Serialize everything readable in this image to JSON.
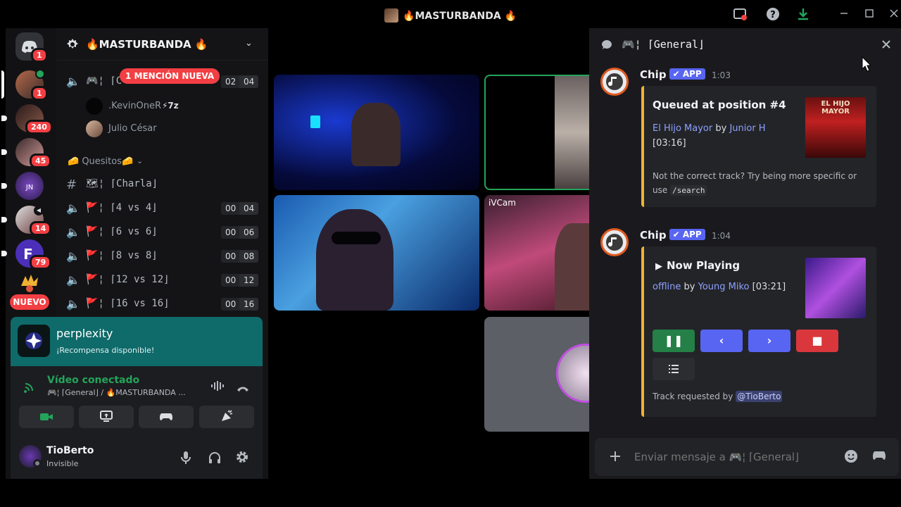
{
  "window": {
    "title": "🔥MASTURBANDA 🔥"
  },
  "rail": {
    "home_badge": "1",
    "servers": [
      {
        "badge": "1"
      },
      {
        "badge": "240"
      },
      {
        "badge": "45"
      },
      {
        "badge": ""
      },
      {
        "badge": "14"
      },
      {
        "badge": "79"
      },
      {
        "badge": ""
      }
    ],
    "new_label": "NUEVO"
  },
  "sidebar": {
    "server_name": "🔥MASTURBANDA 🔥",
    "mention_pill": "1 MENCIÓN NUEVA",
    "top_channel": {
      "name": "🎮¦ ⌈C",
      "count_a": "02",
      "count_b": "04"
    },
    "members": [
      {
        "name": ".KevinOneR",
        "badge": "⚡7z"
      },
      {
        "name": "Julio César",
        "badge": ""
      }
    ],
    "category": "🧀 Quesitos🧀",
    "channels": [
      {
        "icon": "#",
        "name": "🗺¦ ⌈Charla⌋",
        "a": "",
        "b": ""
      },
      {
        "icon": "🔈",
        "name": "🚩¦ ⌈4 vs 4⌋",
        "a": "00",
        "b": "04"
      },
      {
        "icon": "🔈",
        "name": "🚩¦ ⌈6 vs 6⌋",
        "a": "00",
        "b": "06"
      },
      {
        "icon": "🔈",
        "name": "🚩¦ ⌈8 vs 8⌋",
        "a": "00",
        "b": "08"
      },
      {
        "icon": "🔈",
        "name": "🚩¦ ⌈12 vs 12⌋",
        "a": "00",
        "b": "12"
      },
      {
        "icon": "🔈",
        "name": "🚩¦ ⌈16 vs 16⌋",
        "a": "00",
        "b": "16"
      }
    ]
  },
  "promo": {
    "title": "perplexity",
    "subtitle": "¡Recompensa disponible!"
  },
  "voice": {
    "status": "Vídeo conectado",
    "location": "🎮¦ ⌈General⌋ / 🔥MASTURBANDA ..."
  },
  "user": {
    "name": "TioBerto",
    "status": "Invisible"
  },
  "video": {
    "tile_label": "iVCam"
  },
  "chat": {
    "channel": "🎮¦ ⌈General⌋",
    "messages": [
      {
        "author": "Chip",
        "tag": "APP",
        "time": "1:03",
        "embed_title": "Queued at position #4",
        "track": "El Hijo Mayor",
        "by": "by",
        "artist": "Junior H",
        "duration": "[03:16]",
        "footer": "Not the correct track? Try being more specific or use",
        "cmd": "/search",
        "thumb_text": "EL HIJO MAYOR"
      },
      {
        "author": "Chip",
        "tag": "APP",
        "time": "1:04",
        "embed_title": "Now Playing",
        "track": "offline",
        "by": "by",
        "artist": "Young Miko",
        "duration": "[03:21]",
        "footer": "Track requested by",
        "requester": "@TioBerto"
      }
    ],
    "placeholder": "Enviar mensaje a 🎮¦ ⌈General⌋"
  },
  "colors": {
    "accent": "#5865f2",
    "embed_border": "#f0b232",
    "pause": "#248046",
    "stop": "#da373c",
    "connected": "#23a55a",
    "mention": "#f23f43",
    "promo": "#0f6a6a"
  }
}
